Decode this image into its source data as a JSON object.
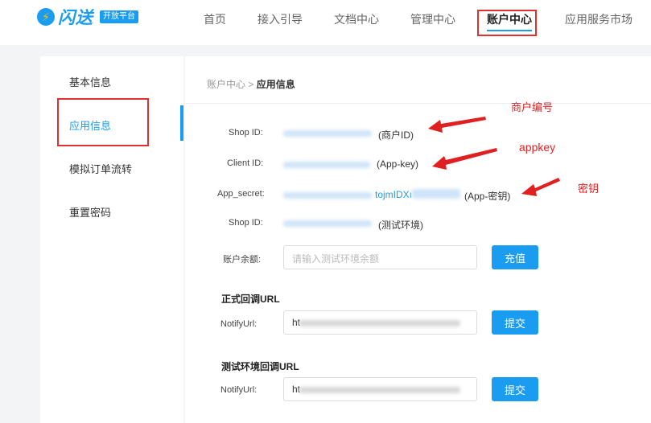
{
  "header": {
    "logo_icon": "⚡",
    "logo_text": "闪送",
    "logo_badge": "开放平台",
    "nav": [
      "首页",
      "接入引导",
      "文档中心",
      "管理中心",
      "账户中心",
      "应用服务市场"
    ],
    "active_nav": "账户中心"
  },
  "sidebar": {
    "items": [
      "基本信息",
      "应用信息",
      "模拟订单流转",
      "重置密码"
    ],
    "active": "应用信息"
  },
  "breadcrumb": {
    "parent": "账户中心",
    "sep": ">",
    "current": "应用信息"
  },
  "fields": {
    "shop_id_label": "Shop ID:",
    "shop_id_note": "(商户ID)",
    "client_id_label": "Client ID:",
    "client_id_note": "(App-key)",
    "app_secret_label": "App_secret:",
    "app_secret_partial": "tojmIDXı",
    "app_secret_note": "(App-密钥)",
    "test_shop_id_label": "Shop ID:",
    "test_shop_id_note": "(测试环境)",
    "balance_label": "账户余额:",
    "balance_placeholder": "请输入测试环境余额",
    "recharge_button": "充值"
  },
  "prod_callback": {
    "title": "正式回调URL",
    "label": "NotifyUrl:",
    "value_prefix": "ht",
    "submit": "提交"
  },
  "test_callback": {
    "title": "测试环境回调URL",
    "label": "NotifyUrl:",
    "value_prefix": "ht",
    "submit": "提交"
  },
  "annotations": {
    "merchant_no": "商户编号",
    "appkey": "appkey",
    "secret": "密钥"
  },
  "colors": {
    "accent": "#1a9cf0",
    "highlight": "#e03030"
  }
}
